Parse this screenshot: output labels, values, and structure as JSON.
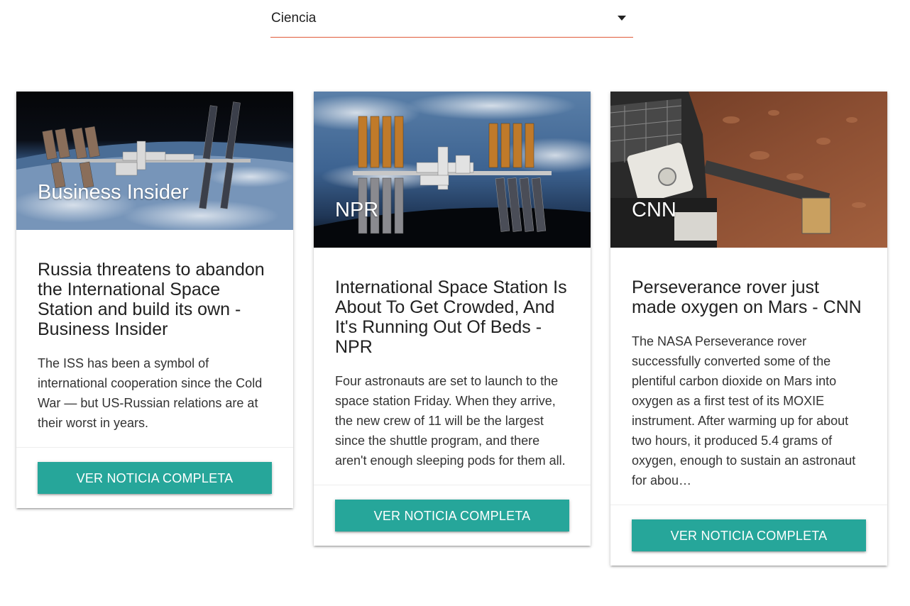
{
  "category_select": {
    "selected": "Ciencia"
  },
  "colors": {
    "accent_underline": "#e15c3a",
    "button": "#26a69a"
  },
  "cards": [
    {
      "source": "Business Insider",
      "title": "Russia threatens to abandon the International Space Station and build its own - Business Insider",
      "description": "The ISS has been a symbol of international cooperation since the Cold War — but US-Russian relations are at their worst in years.",
      "button_label": "VER NOTICIA COMPLETA",
      "image": "space-station-over-earth"
    },
    {
      "source": "NPR",
      "title": "International Space Station Is About To Get Crowded, And It's Running Out Of Beds - NPR",
      "description": "Four astronauts are set to launch to the space station Friday. When they arrive, the new crew of 11 will be the largest since the shuttle program, and there aren't enough sleeping pods for them all.",
      "button_label": "VER NOTICIA COMPLETA",
      "image": "space-station-solar-arrays"
    },
    {
      "source": "CNN",
      "title": "Perseverance rover just made oxygen on Mars - CNN",
      "description": "The NASA Perseverance rover successfully converted some of the plentiful carbon dioxide on Mars into oxygen as a first test of its MOXIE instrument. After warming up for about two hours, it produced 5.4 grams of oxygen, enough to sustain an astronaut for abou…",
      "button_label": "VER NOTICIA COMPLETA",
      "image": "mars-rover-surface"
    }
  ]
}
